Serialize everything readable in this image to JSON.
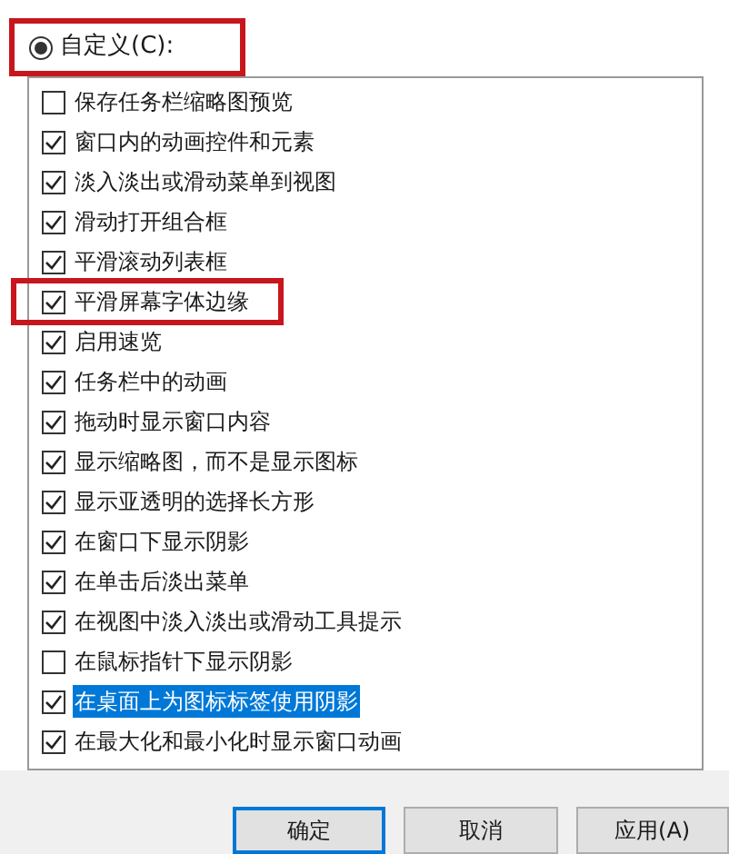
{
  "custom_option": {
    "label": "自定义(C):",
    "selected": true,
    "highlighted": true
  },
  "options": [
    {
      "label": "保存任务栏缩略图预览",
      "checked": false,
      "selected": false,
      "highlighted": false
    },
    {
      "label": "窗口内的动画控件和元素",
      "checked": true,
      "selected": false,
      "highlighted": false
    },
    {
      "label": "淡入淡出或滑动菜单到视图",
      "checked": true,
      "selected": false,
      "highlighted": false
    },
    {
      "label": "滑动打开组合框",
      "checked": true,
      "selected": false,
      "highlighted": false
    },
    {
      "label": "平滑滚动列表框",
      "checked": true,
      "selected": false,
      "highlighted": false
    },
    {
      "label": "平滑屏幕字体边缘",
      "checked": true,
      "selected": false,
      "highlighted": true
    },
    {
      "label": "启用速览",
      "checked": true,
      "selected": false,
      "highlighted": false
    },
    {
      "label": "任务栏中的动画",
      "checked": true,
      "selected": false,
      "highlighted": false
    },
    {
      "label": "拖动时显示窗口内容",
      "checked": true,
      "selected": false,
      "highlighted": false
    },
    {
      "label": "显示缩略图，而不是显示图标",
      "checked": true,
      "selected": false,
      "highlighted": false
    },
    {
      "label": "显示亚透明的选择长方形",
      "checked": true,
      "selected": false,
      "highlighted": false
    },
    {
      "label": "在窗口下显示阴影",
      "checked": true,
      "selected": false,
      "highlighted": false
    },
    {
      "label": "在单击后淡出菜单",
      "checked": true,
      "selected": false,
      "highlighted": false
    },
    {
      "label": "在视图中淡入淡出或滑动工具提示",
      "checked": true,
      "selected": false,
      "highlighted": false
    },
    {
      "label": "在鼠标指针下显示阴影",
      "checked": false,
      "selected": false,
      "highlighted": false
    },
    {
      "label": "在桌面上为图标标签使用阴影",
      "checked": true,
      "selected": true,
      "highlighted": false
    },
    {
      "label": "在最大化和最小化时显示窗口动画",
      "checked": true,
      "selected": false,
      "highlighted": false
    }
  ],
  "buttons": [
    {
      "label": "确定",
      "default": true
    },
    {
      "label": "取消",
      "default": false
    },
    {
      "label": "应用(A)",
      "default": false
    }
  ]
}
